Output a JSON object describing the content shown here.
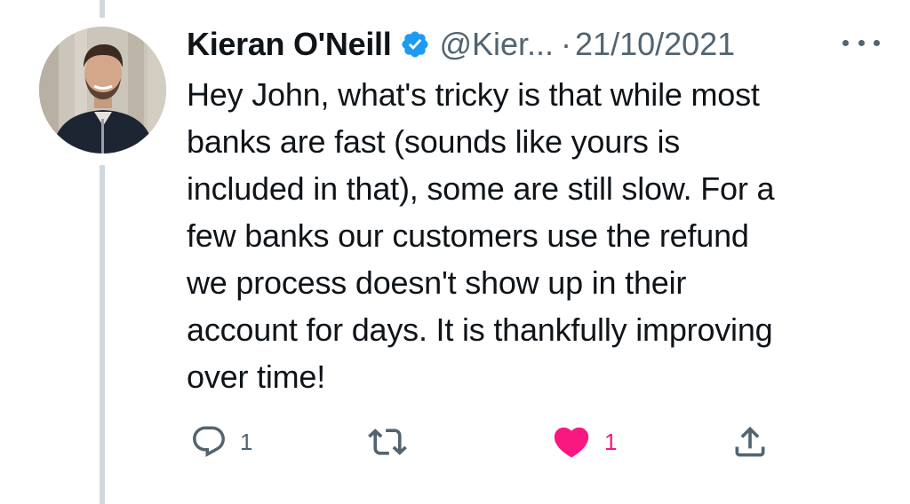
{
  "tweet": {
    "author_name": "Kieran O'Neill",
    "author_handle": "@Kier...",
    "separator": "·",
    "date": "21/10/2021",
    "text": "Hey John, what's tricky is that while most\nbanks are fast (sounds like yours is\nincluded in that), some are still slow. For a\nfew banks our customers use the refund\nwe process doesn't show up in their\naccount for days. It is thankfully improving\nover time!",
    "verified": true
  },
  "actions": {
    "reply_count": "1",
    "retweet_count": "",
    "like_count": "1",
    "liked": true
  },
  "icons": {
    "verified": "verified-badge-icon",
    "more": "more-options-icon",
    "reply": "reply-icon",
    "retweet": "retweet-icon",
    "like": "heart-icon",
    "share": "share-icon"
  },
  "colors": {
    "verified_blue": "#1d9bf0",
    "like_pink": "#f91880",
    "secondary_text": "#536471",
    "primary_text": "#0f1419",
    "thread_line": "#cfd9de"
  }
}
